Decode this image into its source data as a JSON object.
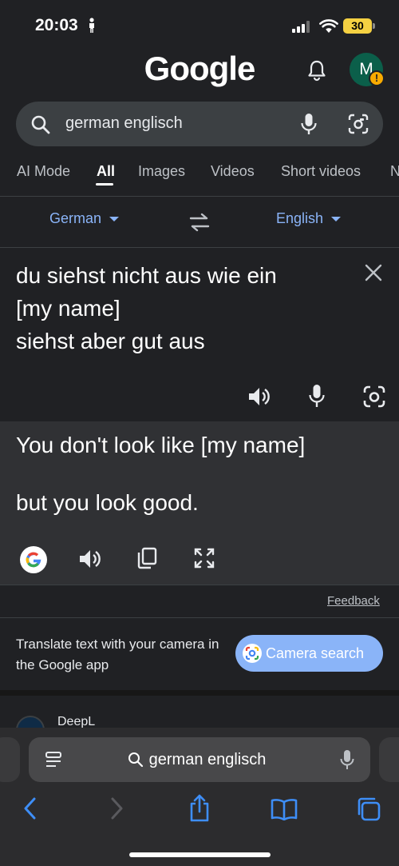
{
  "status": {
    "time": "20:03",
    "battery": "30"
  },
  "header": {
    "logo": "Google",
    "avatar_letter": "M",
    "avatar_badge": "!"
  },
  "search": {
    "query": "german englisch"
  },
  "tabs": [
    {
      "label": "AI Mode"
    },
    {
      "label": "All",
      "active": true
    },
    {
      "label": "Images"
    },
    {
      "label": "Videos"
    },
    {
      "label": "Short videos"
    },
    {
      "label": "N"
    }
  ],
  "translate": {
    "source_lang": "German",
    "target_lang": "English",
    "source_lines": [
      "du siehst nicht aus wie ein",
      "[my name]",
      "siehst aber gut aus"
    ],
    "result_lines": [
      "You don't look like [my name]",
      "but you look good."
    ],
    "feedback": "Feedback"
  },
  "promo": {
    "text": "Translate text with your camera in the Google app",
    "button": "Camera search"
  },
  "next_result": {
    "name": "DeepL"
  },
  "safari": {
    "address": "german englisch"
  },
  "colors": {
    "accent": "#8ab4f8",
    "background": "#202124",
    "surface": "#303134",
    "battery": "#f5d142"
  }
}
